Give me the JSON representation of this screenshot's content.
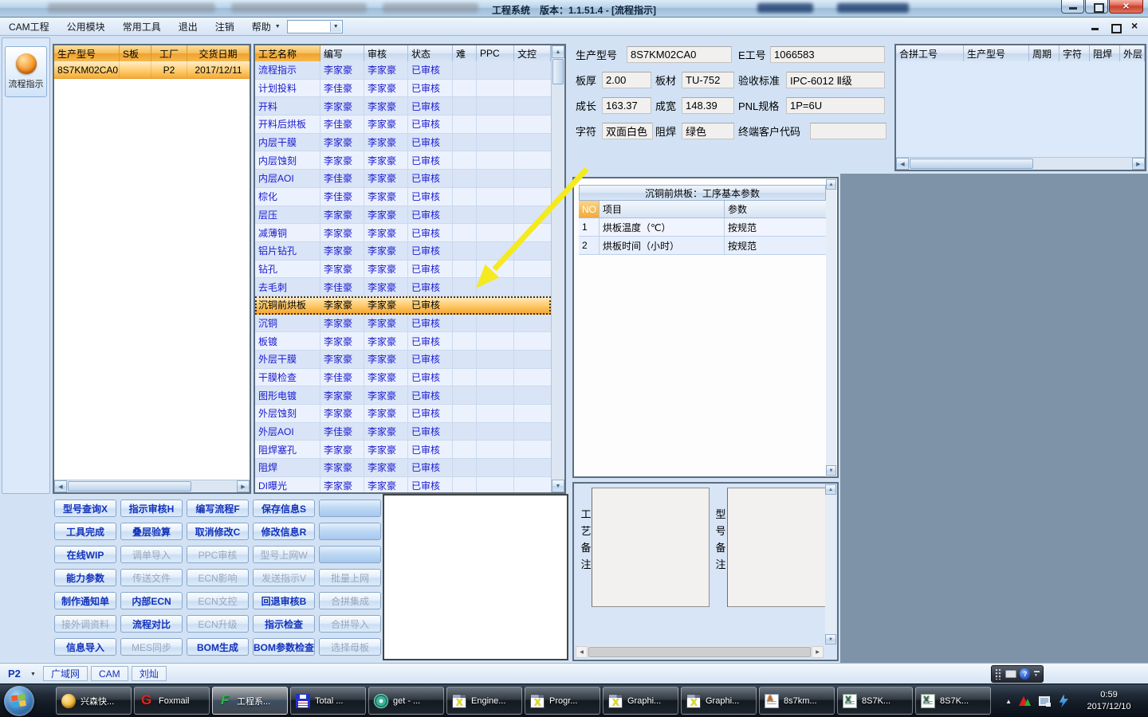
{
  "titlebar": {
    "title": "工程系统　版本：1.1.51.4 - [流程指示]"
  },
  "menubar": {
    "items": [
      "CAM工程",
      "公用模块",
      "常用工具",
      "退出",
      "注销",
      "帮助"
    ]
  },
  "sidebar": {
    "flow_label": "流程指示"
  },
  "model_table": {
    "headers": [
      "生产型号",
      "S板",
      "工厂",
      "交货日期"
    ],
    "rows": [
      {
        "model": "8S7KM02CA0",
        "sboard": "",
        "factory": "P2",
        "date": "2017/12/11",
        "selected": true
      }
    ]
  },
  "process_table": {
    "headers": [
      "工艺名称",
      "编写",
      "审核",
      "状态",
      "难",
      "PPC",
      "文控"
    ],
    "rows": [
      {
        "name": "流程指示",
        "writer": "李家豪",
        "auditor": "李家豪",
        "status": "已审核"
      },
      {
        "name": "计划投料",
        "writer": "李佳豪",
        "auditor": "李家豪",
        "status": "已审核"
      },
      {
        "name": "开料",
        "writer": "李家豪",
        "auditor": "李家豪",
        "status": "已审核"
      },
      {
        "name": "开料后烘板",
        "writer": "李佳豪",
        "auditor": "李家豪",
        "status": "已审核"
      },
      {
        "name": "内层干膜",
        "writer": "李家豪",
        "auditor": "李家豪",
        "status": "已审核"
      },
      {
        "name": "内层蚀刻",
        "writer": "李家豪",
        "auditor": "李家豪",
        "status": "已审核"
      },
      {
        "name": "内层AOI",
        "writer": "李佳豪",
        "auditor": "李家豪",
        "status": "已审核"
      },
      {
        "name": "棕化",
        "writer": "李佳豪",
        "auditor": "李家豪",
        "status": "已审核"
      },
      {
        "name": "层压",
        "writer": "李家豪",
        "auditor": "李家豪",
        "status": "已审核"
      },
      {
        "name": "减薄铜",
        "writer": "李家豪",
        "auditor": "李家豪",
        "status": "已审核"
      },
      {
        "name": "铝片钻孔",
        "writer": "李家豪",
        "auditor": "李家豪",
        "status": "已审核"
      },
      {
        "name": "钻孔",
        "writer": "李家豪",
        "auditor": "李家豪",
        "status": "已审核"
      },
      {
        "name": "去毛刺",
        "writer": "李佳豪",
        "auditor": "李家豪",
        "status": "已审核"
      },
      {
        "name": "沉铜前烘板",
        "writer": "李家豪",
        "auditor": "李家豪",
        "status": "已审核",
        "selected": true
      },
      {
        "name": "沉铜",
        "writer": "李家豪",
        "auditor": "李家豪",
        "status": "已审核"
      },
      {
        "name": "板镀",
        "writer": "李家豪",
        "auditor": "李家豪",
        "status": "已审核"
      },
      {
        "name": "外层干膜",
        "writer": "李家豪",
        "auditor": "李家豪",
        "status": "已审核"
      },
      {
        "name": "干膜检查",
        "writer": "李佳豪",
        "auditor": "李家豪",
        "status": "已审核"
      },
      {
        "name": "图形电镀",
        "writer": "李家豪",
        "auditor": "李家豪",
        "status": "已审核"
      },
      {
        "name": "外层蚀刻",
        "writer": "李家豪",
        "auditor": "李家豪",
        "status": "已审核"
      },
      {
        "name": "外层AOI",
        "writer": "李佳豪",
        "auditor": "李家豪",
        "status": "已审核"
      },
      {
        "name": "阻焊塞孔",
        "writer": "李家豪",
        "auditor": "李家豪",
        "status": "已审核"
      },
      {
        "name": "阻焊",
        "writer": "李家豪",
        "auditor": "李家豪",
        "status": "已审核"
      },
      {
        "name": "DI曝光",
        "writer": "李家豪",
        "auditor": "李家豪",
        "status": "已审核"
      }
    ]
  },
  "info_form": {
    "fields": [
      {
        "label": "生产型号",
        "value": "8S7KM02CA0"
      },
      {
        "label": "E工号",
        "value": "1066583"
      },
      {
        "label": "板厚",
        "value": "2.00"
      },
      {
        "label": "板材",
        "value": "TU-752"
      },
      {
        "label": "验收标准",
        "value": "IPC-6012 Ⅱ级"
      },
      {
        "label": "成长",
        "value": "163.37"
      },
      {
        "label": "成宽",
        "value": "148.39"
      },
      {
        "label": "PNL规格",
        "value": "1P=6U"
      },
      {
        "label": "字符",
        "value": "双面白色"
      },
      {
        "label": "阻焊",
        "value": "绿色"
      },
      {
        "label": "终端客户代码",
        "value": ""
      }
    ]
  },
  "merge_table": {
    "headers": [
      "合拼工号",
      "生产型号",
      "周期",
      "字符",
      "阻焊",
      "外层"
    ]
  },
  "param_panel": {
    "title": "沉铜前烘板：工序基本参数",
    "headers": [
      "NO",
      "项目",
      "参数"
    ],
    "rows": [
      {
        "no": "1",
        "item": "烘板温度（℃）",
        "param": "按规范"
      },
      {
        "no": "2",
        "item": "烘板时间（小时）",
        "param": "按规范"
      }
    ]
  },
  "remarks": {
    "process_label": "工艺备注",
    "model_label": "型号备注",
    "process_value": "",
    "model_value": ""
  },
  "actions": {
    "buttons": [
      {
        "label": "型号查询X",
        "state": "on"
      },
      {
        "label": "指示审核H",
        "state": "on"
      },
      {
        "label": "编写流程F",
        "state": "on"
      },
      {
        "label": "保存信息S",
        "state": "on"
      },
      {
        "label": "",
        "state": "blank"
      },
      {
        "label": "工具完成",
        "state": "on"
      },
      {
        "label": "叠层验算",
        "state": "on"
      },
      {
        "label": "取消修改C",
        "state": "on"
      },
      {
        "label": "修改信息R",
        "state": "on"
      },
      {
        "label": "",
        "state": "blank"
      },
      {
        "label": "在线WIP",
        "state": "on"
      },
      {
        "label": "调单导入",
        "state": "off"
      },
      {
        "label": "PPC审核",
        "state": "off"
      },
      {
        "label": "型号上网W",
        "state": "off"
      },
      {
        "label": "",
        "state": "blank"
      },
      {
        "label": "能力参数",
        "state": "on"
      },
      {
        "label": "传送文件",
        "state": "off"
      },
      {
        "label": "ECN影响",
        "state": "off"
      },
      {
        "label": "发送指示V",
        "state": "off"
      },
      {
        "label": "批量上网",
        "state": "off"
      },
      {
        "label": "制作通知单",
        "state": "on"
      },
      {
        "label": "内部ECN",
        "state": "on"
      },
      {
        "label": "ECN文控",
        "state": "off"
      },
      {
        "label": "回退审核B",
        "state": "on"
      },
      {
        "label": "合拼集成",
        "state": "off"
      },
      {
        "label": "接外调资料",
        "state": "off"
      },
      {
        "label": "流程对比",
        "state": "on"
      },
      {
        "label": "ECN升级",
        "state": "off"
      },
      {
        "label": "指示检查",
        "state": "on"
      },
      {
        "label": "合拼导入",
        "state": "off"
      },
      {
        "label": "信息导入",
        "state": "on"
      },
      {
        "label": "MES同步",
        "state": "off"
      },
      {
        "label": "BOM生成",
        "state": "on"
      },
      {
        "label": "BOM参数检查",
        "state": "on"
      },
      {
        "label": "选择母板",
        "state": "off"
      }
    ]
  },
  "statusbar": {
    "site": "P2",
    "cells": [
      "广域网",
      "CAM",
      "刘灿"
    ]
  },
  "taskbar": {
    "items": [
      {
        "label": "兴森快...",
        "icon": "shell"
      },
      {
        "label": "Foxmail",
        "icon": "foxmail"
      },
      {
        "label": "工程系...",
        "icon": "engsys",
        "active": true
      },
      {
        "label": "Total ...",
        "icon": "floppy"
      },
      {
        "label": "get - ...",
        "icon": "cd"
      },
      {
        "label": "Engine...",
        "icon": "xwin"
      },
      {
        "label": "Progr...",
        "icon": "xwin"
      },
      {
        "label": "Graphi...",
        "icon": "xwin"
      },
      {
        "label": "Graphi...",
        "icon": "xwin"
      },
      {
        "label": "8s7km...",
        "icon": "doc"
      },
      {
        "label": "8S7K...",
        "icon": "excel"
      },
      {
        "label": "8S7K...",
        "icon": "excel"
      }
    ],
    "tray": {
      "time": "0:59",
      "date": "2017/12/10"
    }
  },
  "colors": {
    "selection_orange": "#f5a52d",
    "accent_blue": "#1433bb",
    "row_text_blue": "#1a1acd",
    "mdi_background": "#7e93a8"
  }
}
